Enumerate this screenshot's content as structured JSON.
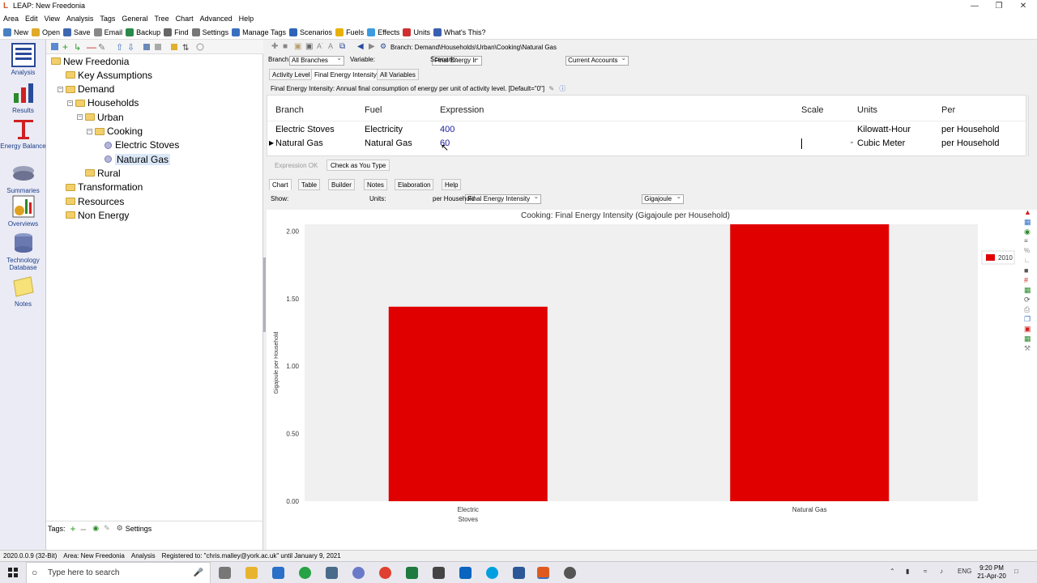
{
  "window": {
    "title": "LEAP: New Freedonia"
  },
  "menu": [
    "Area",
    "Edit",
    "View",
    "Analysis",
    "Tags",
    "General",
    "Tree",
    "Chart",
    "Advanced",
    "Help"
  ],
  "toolbar": [
    {
      "label": "New",
      "icon": "new-icon",
      "color": "#4a7fc1"
    },
    {
      "label": "Open",
      "icon": "open-icon",
      "color": "#e0a92a"
    },
    {
      "label": "Save",
      "icon": "save-icon",
      "color": "#3f66b0"
    },
    {
      "label": "Email",
      "icon": "email-icon",
      "color": "#888888"
    },
    {
      "label": "Backup",
      "icon": "backup-icon",
      "color": "#2a8a4a"
    },
    {
      "label": "Find",
      "icon": "find-icon",
      "color": "#666666"
    },
    {
      "label": "Settings",
      "icon": "settings-icon",
      "color": "#777777"
    },
    {
      "label": "Manage Tags",
      "icon": "tag-icon",
      "color": "#3a6fc0"
    },
    {
      "label": "Scenarios",
      "icon": "scenarios-icon",
      "color": "#2d64b8"
    },
    {
      "label": "Fuels",
      "icon": "fuels-icon",
      "color": "#e8b100"
    },
    {
      "label": "Effects",
      "icon": "effects-icon",
      "color": "#3d9be0"
    },
    {
      "label": "Units",
      "icon": "units-icon",
      "color": "#d03030"
    },
    {
      "label": "What's This?",
      "icon": "help-icon",
      "color": "#3b5fb0"
    }
  ],
  "views": [
    {
      "label": "Analysis",
      "icon": "analysis-icon"
    },
    {
      "label": "Results",
      "icon": "results-icon"
    },
    {
      "label": "Energy Balance",
      "icon": "energy-balance-icon"
    },
    {
      "label": "Summaries",
      "icon": "summaries-icon"
    },
    {
      "label": "Overviews",
      "icon": "overviews-icon"
    },
    {
      "label": "Technology Database",
      "icon": "technology-database-icon"
    },
    {
      "label": "Notes",
      "icon": "notes-icon"
    }
  ],
  "tree": [
    {
      "label": "New Freedonia",
      "type": "folder",
      "toggle": ""
    },
    {
      "label": "Key Assumptions",
      "type": "folder",
      "toggle": ""
    },
    {
      "label": "Demand",
      "type": "folder",
      "toggle": "-"
    },
    {
      "label": "Households",
      "type": "folder",
      "toggle": "-"
    },
    {
      "label": "Urban",
      "type": "folder",
      "toggle": "-"
    },
    {
      "label": "Cooking",
      "type": "folder",
      "toggle": "-"
    },
    {
      "label": "Electric Stoves",
      "type": "leaf",
      "toggle": ""
    },
    {
      "label": "Natural Gas",
      "type": "leaf",
      "toggle": "",
      "selected": true
    },
    {
      "label": "Rural",
      "type": "folder",
      "toggle": ""
    },
    {
      "label": "Transformation",
      "type": "folder",
      "toggle": ""
    },
    {
      "label": "Resources",
      "type": "folder",
      "toggle": ""
    },
    {
      "label": "Non Energy",
      "type": "folder",
      "toggle": ""
    }
  ],
  "tags": {
    "label": "Tags:",
    "settings": "Settings"
  },
  "breadcrumb": "Branch: Demand\\Households\\Urban\\Cooking\\Natural Gas",
  "filters": {
    "branch_label": "Branch:",
    "branch_value": "All Branches",
    "variable_label": "Variable:",
    "variable_value": "Final Energy Ir",
    "scenario_label": "Scenario:",
    "scenario_value": "Current Accounts"
  },
  "variable_tabs": [
    "Activity Level",
    "Final Energy Intensity",
    "All Variables"
  ],
  "description": "Final Energy Intensity: Annual final consumption of energy per unit of activity level. [Default=\"0\"]",
  "grid": {
    "headers": [
      "Branch",
      "Fuel",
      "Expression",
      "Scale",
      "Units",
      "Per"
    ],
    "rows": [
      {
        "branch": "Electric Stoves",
        "fuel": "Electricity",
        "expression": "400",
        "scale": "",
        "units": "Kilowatt-Hour",
        "per": "per Household"
      },
      {
        "branch": "Natural Gas",
        "fuel": "Natural Gas",
        "expression": "60",
        "scale": "",
        "units": "Cubic Meter",
        "per": "per Household"
      }
    ]
  },
  "status": {
    "ok": "Expression OK",
    "check": "Check as You Type"
  },
  "bottom_tabs": [
    "Chart",
    "Table",
    "Builder",
    "Notes",
    "Elaboration",
    "Help"
  ],
  "chart_controls": {
    "show_label": "Show:",
    "show_value": "Final Energy Intensity",
    "units_label": "Units:",
    "units_value": "Gigajoule",
    "per": "per Household"
  },
  "chart_data": {
    "type": "bar",
    "title": "Cooking: Final Energy Intensity (Gigajoule per Household)",
    "categories": [
      "Electric Stoves",
      "Natural Gas"
    ],
    "series": [
      {
        "name": "2010",
        "values": [
          1.44,
          2.05
        ],
        "color": "#e00000"
      }
    ],
    "ylabel": "Gigajoule per Household",
    "ylim": [
      0,
      2.0
    ],
    "yticks": [
      "0.00",
      "0.50",
      "1.00",
      "1.50",
      "2.00"
    ],
    "legend": "top-right",
    "grid": false
  },
  "statusbar": [
    "2020.0.0.9 (32-Bit)",
    "Area: New Freedonia",
    "Analysis",
    "Registered to: \"chris.malley@york.ac.uk\" until January 9, 2021"
  ],
  "taskbar": {
    "search_placeholder": "Type here to search",
    "lang": "ENG",
    "time": "9:20 PM",
    "date": "21-Apr-20"
  }
}
